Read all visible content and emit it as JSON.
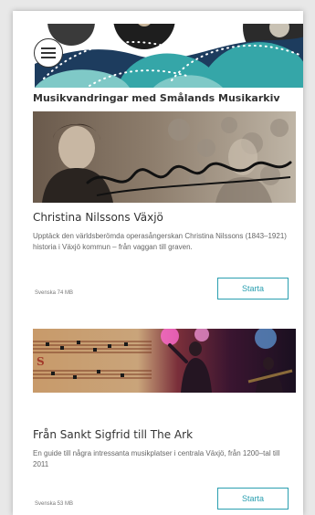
{
  "header": {
    "title": "Musikvandringar med Smålands Musikarkiv"
  },
  "menu": {
    "icon": "hamburger-menu-icon"
  },
  "colors": {
    "accent": "#2a9fb0",
    "banner_teal": "#35a6a8",
    "banner_light": "#7fc9c7",
    "banner_dark": "#1d3c5e"
  },
  "walks": [
    {
      "title": "Christina Nilssons Växjö",
      "description": "Upptäck den världsberömda operasångerskan Christina Nilssons (1843–1921) historia i Växjö kommun – från vaggan till graven.",
      "meta": "Svenska 74 MB",
      "button": "Starta"
    },
    {
      "title": "Från Sankt Sigfrid till The Ark",
      "description": "En guide till några intressanta musikplatser i centrala Växjö, från 1200–tal till 2011",
      "meta": "Svenska 53 MB",
      "button": "Starta"
    }
  ]
}
